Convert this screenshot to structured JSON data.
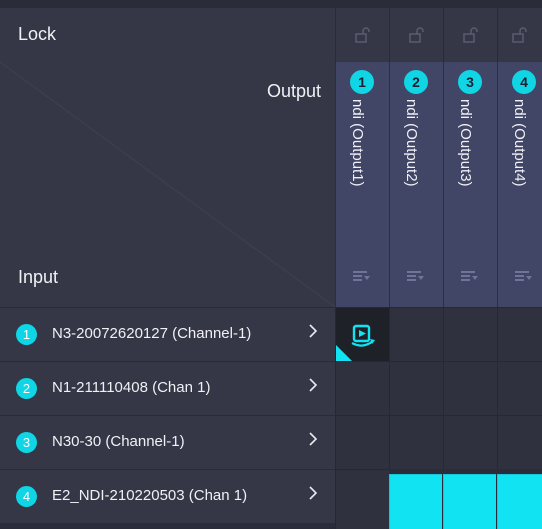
{
  "header": {
    "lock_label": "Lock",
    "output_label": "Output",
    "input_label": "Input"
  },
  "outputs": [
    {
      "number": "1",
      "name": "ndi (Output1)"
    },
    {
      "number": "2",
      "name": "ndi (Output2)"
    },
    {
      "number": "3",
      "name": "ndi (Output3)"
    },
    {
      "number": "4",
      "name": "ndi (Output4)"
    }
  ],
  "inputs": [
    {
      "number": "1",
      "name": "N3-20072620127 (Channel-1)"
    },
    {
      "number": "2",
      "name": "N1-211110408 (Chan 1)"
    },
    {
      "number": "3",
      "name": "N30-30 (Channel-1)"
    },
    {
      "number": "4",
      "name": "E2_NDI-210220503 (Chan 1)"
    }
  ],
  "routing": {
    "current_cell": {
      "input": 1,
      "output": 1,
      "icon": "route-switch-icon"
    },
    "active_cells": [
      {
        "input": 4,
        "output": 2
      },
      {
        "input": 4,
        "output": 3
      },
      {
        "input": 4,
        "output": 4
      }
    ]
  },
  "colors": {
    "accent": "#12e3f3",
    "header_bg": "#353746",
    "output_header_bg": "#414566",
    "cell_bg": "#2f313f"
  },
  "icons": {
    "lock": "unlocked-padlock-icon",
    "filter": "filter-list-icon",
    "chevron": "chevron-right-icon"
  }
}
